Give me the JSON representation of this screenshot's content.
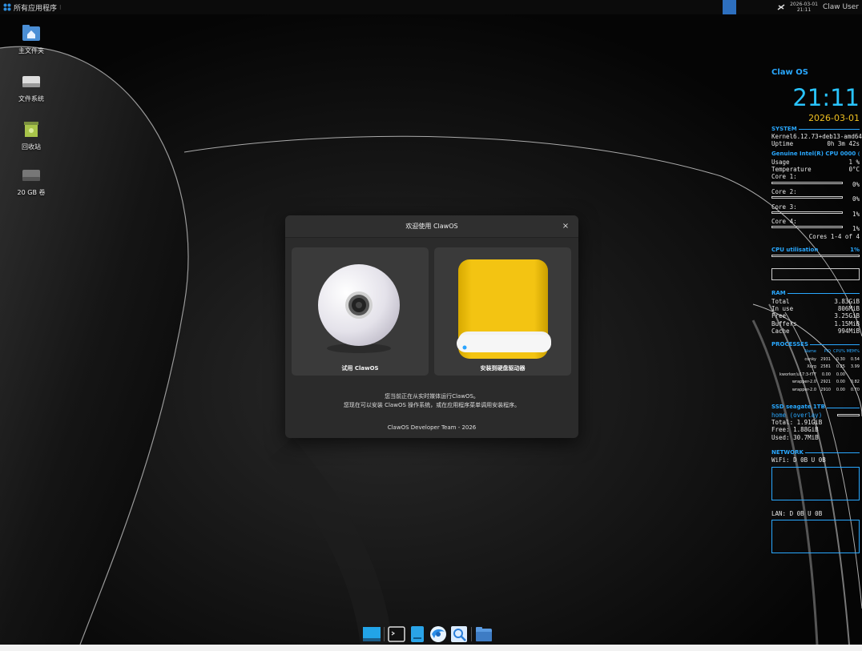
{
  "top_panel": {
    "app_menu_label": "所有应用程序",
    "date": "2026-03-01",
    "time": "21:11",
    "user": "Claw User"
  },
  "desktop_icons": [
    {
      "label": "主文件夹",
      "icon": "home-folder-icon"
    },
    {
      "label": "文件系统",
      "icon": "drive-icon"
    },
    {
      "label": "回收站",
      "icon": "trash-icon"
    },
    {
      "label": "20 GB 卷",
      "icon": "drive-icon"
    }
  ],
  "conky": {
    "title": "Claw OS",
    "time": "21:11",
    "date": "2026-03-01",
    "system": {
      "header": "SYSTEM",
      "kernel_label": "Kernel",
      "kernel": "6.12.73+deb13-amd64",
      "uptime_label": "Uptime",
      "uptime": "0h 3m 42s"
    },
    "cpu": {
      "header": "Genuine Intel(R) CPU 0000 @",
      "usage_label": "Usage",
      "usage": "1 %",
      "temp_label": "Temperature",
      "temp": "0°C",
      "cores": [
        {
          "label": "Core 1:",
          "value": "0%"
        },
        {
          "label": "Core 2:",
          "value": "0%"
        },
        {
          "label": "Core 3:",
          "value": "1%"
        },
        {
          "label": "Core 4:",
          "value": "1%"
        }
      ],
      "cores_footer": "Cores 1-4 of 4",
      "util_label": "CPU utilisation",
      "util_value": "1%"
    },
    "ram": {
      "header": "RAM",
      "rows": [
        {
          "label": "Total",
          "value": "3.83GiB"
        },
        {
          "label": "In use",
          "value": "806MiB"
        },
        {
          "label": "Free",
          "value": "3.25GiB"
        },
        {
          "label": "Buffers",
          "value": "1.15MiB"
        },
        {
          "label": "Cache",
          "value": "994MiB"
        }
      ]
    },
    "processes": {
      "header": "PROCESSES",
      "columns": [
        "Name",
        "PID",
        "CPU%",
        "MEM%"
      ],
      "rows": [
        [
          "conky",
          "2931",
          "0.30",
          "0.54"
        ],
        [
          "Xorg",
          "2581",
          "0.25",
          "3.99"
        ],
        [
          "kworker/u17:3-f77",
          "0.00",
          "0.00",
          ""
        ],
        [
          "wrapper-2.0",
          "2921",
          "0.00",
          "0.82"
        ],
        [
          "wrapper-2.0",
          "2910",
          "0.00",
          "0.70"
        ]
      ]
    },
    "disk": {
      "header": "SSD seagate 1TB",
      "mount": "home (overlay)",
      "total": "Total: 1.91GiB",
      "free": "Free: 1.88GiB",
      "used": "Used: 30.7MiB"
    },
    "network": {
      "header": "NETWORK",
      "wifi": "WiFi: D 0B  U 0B",
      "lan": "LAN: D 0B  U 0B"
    }
  },
  "dialog": {
    "title": "欢迎使用 ClawOS",
    "try_label": "试用 ClawOS",
    "install_label": "安装到硬盘驱动器",
    "text_line1": "您当前正在从实时媒体运行ClawOS。",
    "text_line2": "您现在可以安装 ClawOS 操作系统，或在应用程序菜单调用安装程序。",
    "footer": "ClawOS Developer Team - 2026"
  },
  "dock": {
    "items": [
      "desktop-icon",
      "terminal-icon",
      "text-editor-icon",
      "browser-icon",
      "search-icon",
      "file-manager-icon"
    ]
  }
}
